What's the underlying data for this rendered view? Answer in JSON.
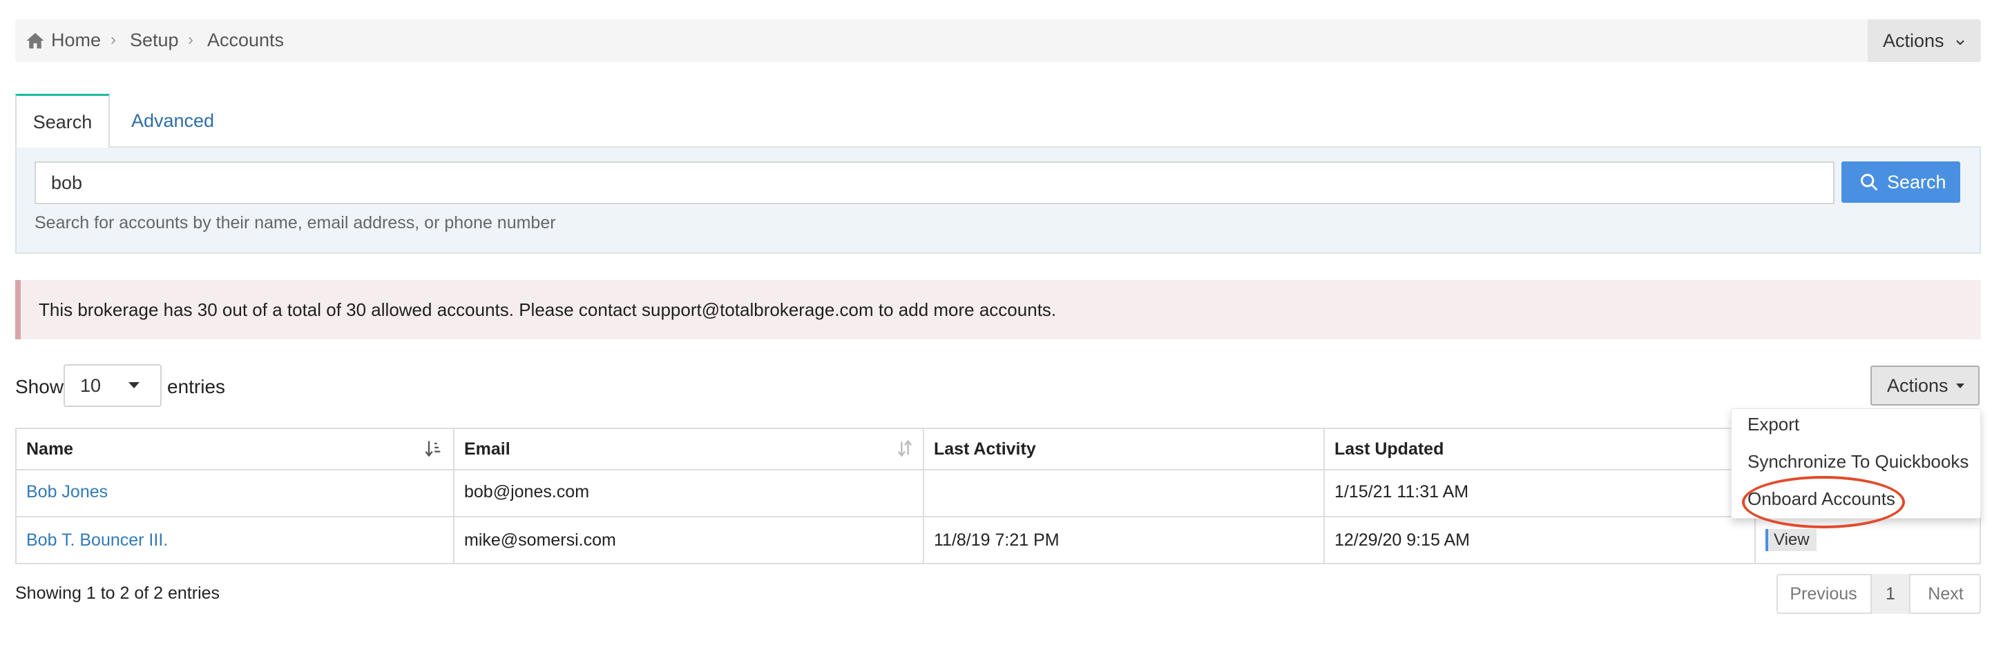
{
  "breadcrumb": {
    "items": [
      {
        "label": "Home",
        "icon": "home-icon"
      },
      {
        "label": "Setup"
      },
      {
        "label": "Accounts"
      }
    ],
    "separator": "›"
  },
  "top_actions": {
    "label": "Actions",
    "icon": "chevron-down-icon"
  },
  "tabs": [
    {
      "label": "Search",
      "active": true
    },
    {
      "label": "Advanced",
      "active": false
    }
  ],
  "search": {
    "value": "bob",
    "button_label": "Search",
    "button_icon": "search-icon",
    "help_text": "Search for accounts by their name, email address, or phone number"
  },
  "alert": {
    "text": "This brokerage has 30 out of a total of 30 allowed accounts. Please contact support@totalbrokerage.com to add more accounts."
  },
  "table_controls": {
    "show_label": "Show",
    "length_value": "10",
    "entries_label": "entries",
    "actions_label": "Actions"
  },
  "dropdown": {
    "items": [
      "Export",
      "Synchronize To Quickbooks",
      "Onboard Accounts"
    ],
    "highlighted_item": "Onboard Accounts"
  },
  "table": {
    "columns": [
      "Name",
      "Email",
      "Last Activity",
      "Last Updated"
    ],
    "rows": [
      {
        "name": "Bob Jones",
        "email": "bob@jones.com",
        "last_activity": "",
        "last_updated": "1/15/21 11:31 AM",
        "action": ""
      },
      {
        "name": "Bob T. Bouncer III.",
        "email": "mike@somersi.com",
        "last_activity": "11/8/19 7:21 PM",
        "last_updated": "12/29/20 9:15 AM",
        "action": "View"
      }
    ]
  },
  "footer": {
    "info": "Showing 1 to 2 of 2 entries",
    "pagination": {
      "previous": "Previous",
      "current": "1",
      "next": "Next"
    }
  },
  "colors": {
    "link": "#337ab7",
    "primary_button": "#4a90e2",
    "tab_accent": "#1abb9c",
    "alert_bg": "#f6eeee",
    "highlight_circle": "#e24a2b"
  }
}
